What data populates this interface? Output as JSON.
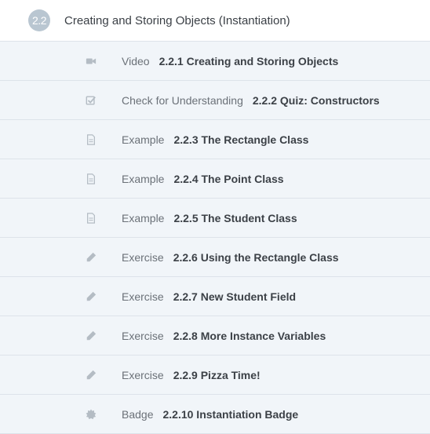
{
  "section": {
    "number": "2.2",
    "title": "Creating and Storing Objects (Instantiation)"
  },
  "items": [
    {
      "icon": "video-camera-icon",
      "type": "Video",
      "name": "2.2.1 Creating and Storing Objects"
    },
    {
      "icon": "checkbox-icon",
      "type": "Check for Understanding",
      "name": "2.2.2 Quiz: Constructors"
    },
    {
      "icon": "document-icon",
      "type": "Example",
      "name": "2.2.3 The Rectangle Class"
    },
    {
      "icon": "document-icon",
      "type": "Example",
      "name": "2.2.4 The Point Class"
    },
    {
      "icon": "document-icon",
      "type": "Example",
      "name": "2.2.5 The Student Class"
    },
    {
      "icon": "pencil-icon",
      "type": "Exercise",
      "name": "2.2.6 Using the Rectangle Class"
    },
    {
      "icon": "pencil-icon",
      "type": "Exercise",
      "name": "2.2.7 New Student Field"
    },
    {
      "icon": "pencil-icon",
      "type": "Exercise",
      "name": "2.2.8 More Instance Variables"
    },
    {
      "icon": "pencil-icon",
      "type": "Exercise",
      "name": "2.2.9 Pizza Time!"
    },
    {
      "icon": "badge-icon",
      "type": "Badge",
      "name": "2.2.10 Instantiation Badge"
    }
  ],
  "colors": {
    "row_background": "#f1f5f9",
    "icon": "#b4bcc4",
    "section_badge": "#b9c6d1"
  }
}
